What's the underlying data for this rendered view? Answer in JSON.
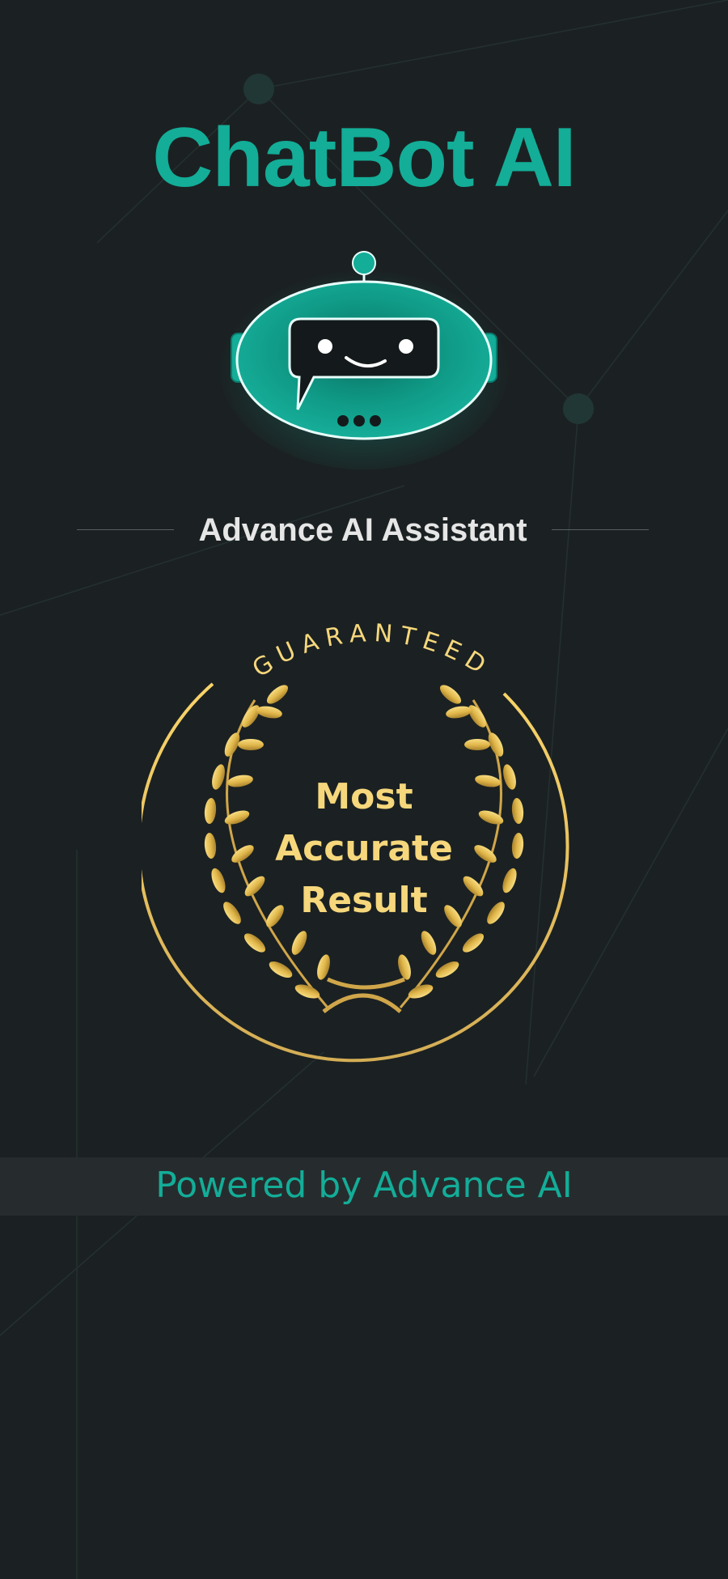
{
  "header": {
    "title": "ChatBot AI"
  },
  "hero": {
    "robot_icon": "chatbot-robot-icon",
    "subtitle": "Advance AI Assistant"
  },
  "badge": {
    "arc_text": "GUARANTEED",
    "line1": "Most",
    "line2": "Accurate",
    "line3": "Result",
    "icon": "laurel-wreath-icon"
  },
  "footer": {
    "powered_by": "Powered by Advance AI"
  },
  "colors": {
    "background": "#1b2122",
    "accent": "#13ad98",
    "gold": "#f6d77c",
    "subtitle": "#e6e6e6",
    "footer_band": "#262c2d"
  }
}
